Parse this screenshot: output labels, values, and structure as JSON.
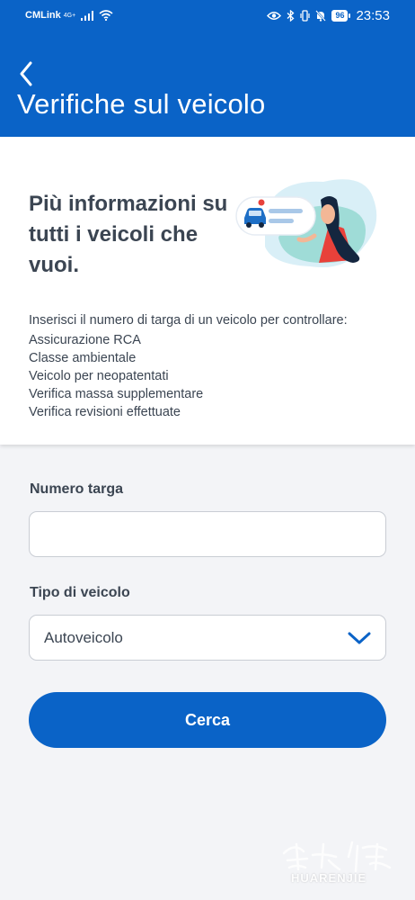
{
  "status_bar": {
    "carrier": "CMLink",
    "network": "4G+",
    "battery": "96",
    "time": "23:53",
    "icons": [
      "signal-icon",
      "wifi-icon",
      "eye-icon",
      "bluetooth-icon",
      "vibrate-icon",
      "bell-off-icon",
      "battery-icon"
    ]
  },
  "header": {
    "back_icon": "chevron-left-icon",
    "title": "Verifiche sul veicolo"
  },
  "info": {
    "headline": "Più informazioni su tutti i veicoli che vuoi.",
    "intro": "Inserisci il numero di targa di un veicolo per controllare:",
    "features": [
      "Assicurazione RCA",
      "Classe ambientale",
      "Veicolo per neopatentati",
      "Verifica massa supplementare",
      "Verifica revisioni effettuate"
    ]
  },
  "form": {
    "plate_label": "Numero targa",
    "plate_value": "",
    "type_label": "Tipo di veicolo",
    "type_value": "Autoveicolo",
    "dropdown_icon": "chevron-down-icon",
    "search_label": "Cerca"
  },
  "watermark": {
    "latin": "HUARENJIE"
  },
  "colors": {
    "primary": "#0a63c7",
    "text": "#3b4552",
    "background": "#f3f4f7"
  }
}
